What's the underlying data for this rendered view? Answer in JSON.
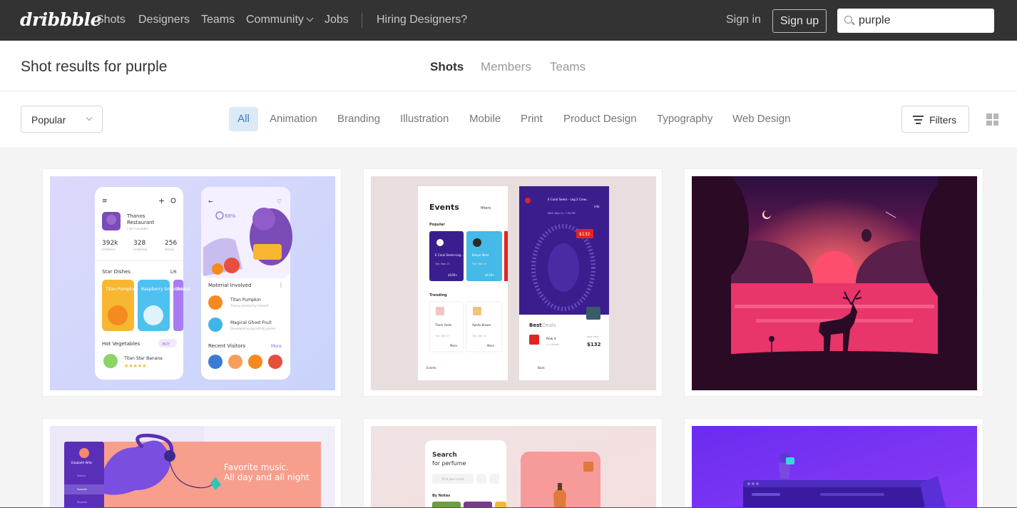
{
  "nav": {
    "logo": "dribbble",
    "links": [
      "Shots",
      "Designers",
      "Teams",
      "Community",
      "Jobs",
      "Hiring Designers?"
    ],
    "signin": "Sign in",
    "signup": "Sign up",
    "search_value": "purple"
  },
  "results": {
    "title": "Shot results for purple",
    "tabs": [
      "Shots",
      "Members",
      "Teams"
    ],
    "active_tab": "Shots"
  },
  "filters": {
    "sort": "Popular",
    "categories": [
      "All",
      "Animation",
      "Branding",
      "Illustration",
      "Mobile",
      "Print",
      "Product Design",
      "Typography",
      "Web Design"
    ],
    "active_category": "All",
    "filters_label": "Filters"
  },
  "shots": {
    "shot1": {
      "left_phone": {
        "name": "Thanos",
        "name2": "Restaurant",
        "tagline": "I am inevitable",
        "stats": [
          {
            "value": "392k",
            "label": "Followers"
          },
          {
            "value": "328",
            "label": "Following"
          },
          {
            "value": "256",
            "label": "Dishes"
          }
        ],
        "section": "Star Dishes",
        "page": "1/6",
        "dishes": [
          "Titan Pumpkin",
          "Raspberry Smoothie",
          "Uni Sal"
        ],
        "veg_title": "Hot Vegetables",
        "veg_item": "Titan Star Banana",
        "buy": "BUY"
      },
      "right_phone": {
        "percent": "68%",
        "material_title": "Material Involved",
        "items": [
          {
            "name": "Titan Pumpkin",
            "sub": "Thanos planted by himself"
          },
          {
            "name": "Magical Ghost Fruit",
            "sub": "Developed using Infinity planes"
          }
        ],
        "visitors": "Recent Visitors",
        "more": "More"
      }
    },
    "shot2": {
      "events_title": "Events",
      "filters": "filters",
      "popular": "Popular",
      "cards": [
        {
          "name": "E Coral Semis-Leg...",
          "date": "Tue, Nov 15",
          "price": "$100+"
        },
        {
          "name": "Kanye West",
          "date": "Tue, Nov 15",
          "price": "$150+"
        }
      ],
      "trending": "Trending",
      "trend_cards": [
        {
          "name": "Thom Yorke",
          "date": "Tue, Nov 17"
        },
        {
          "name": "Apollo Brown",
          "date": "Tue, Dec 21"
        }
      ],
      "more": "More",
      "bottom_nav": "Events",
      "detail_title": "E Coral Semis - Leg 2 Crew...",
      "detail_date": "Wed, Nov 11, 7:30 PM",
      "info": "info",
      "price_tag": "$132",
      "best": "Best",
      "deals": "Deals",
      "row": "Row 4",
      "tickets": "4 x tickets",
      "best_deal": "best deal",
      "deal_price": "$132",
      "back": "Back"
    },
    "shot4": {
      "line1": "Favorite music.",
      "line2": "All day and all night",
      "profile": "Elizabeth Wills",
      "menu": [
        "Search",
        "Favorite",
        "Playlists"
      ]
    },
    "shot5": {
      "title": "Search",
      "subtitle": "for perfume",
      "placeholder": "Find your scent",
      "notes": "By Notes"
    }
  },
  "colors": {
    "nav_bg": "#333333",
    "accent": "#3a7bbf",
    "active_pill": "#dbeaf4"
  }
}
